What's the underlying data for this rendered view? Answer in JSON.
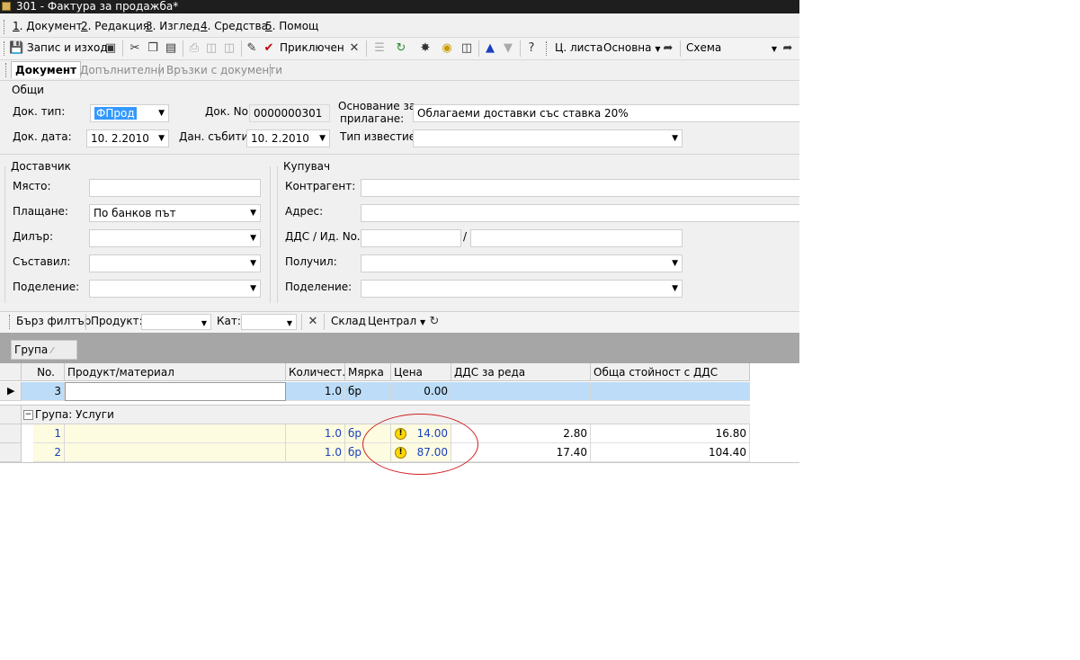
{
  "window": {
    "title": "301 - Фактура за продажба*"
  },
  "menu": [
    {
      "num": "1",
      "label": ". Документ"
    },
    {
      "num": "2",
      "label": ". Редакция"
    },
    {
      "num": "3",
      "label": ". Изглед"
    },
    {
      "num": "4",
      "label": ". Средства"
    },
    {
      "num": "5",
      "label": ". Помощ"
    }
  ],
  "toolbar": {
    "save_exit": "Запис и изход",
    "finish": "Приключен",
    "price_list_label": "Ц. листа",
    "price_list_value": "Основна",
    "scheme_label": "Схема",
    "scheme_value": ""
  },
  "tabs": {
    "document": "Документ",
    "additional": "Допълнителни",
    "links": "Връзки с документи"
  },
  "general": {
    "title": "Общи",
    "doc_type_label": "Док. тип:",
    "doc_type_value": "ФПрод",
    "doc_no_label": "Док. No.",
    "doc_no_value": "0000000301",
    "basis_label_1": "Основание за",
    "basis_label_2": "прилагане:",
    "basis_value": "Облагаеми доставки със ставка 20%",
    "doc_date_label": "Док. дата:",
    "doc_date_value": "10.  2.2010",
    "tax_event_label": "Дан. събитие:",
    "tax_event_value": "10.  2.2010",
    "notice_type_label": "Тип известие:",
    "notice_type_value": ""
  },
  "supplier": {
    "title": "Доставчик",
    "place_label": "Място:",
    "payment_label": "Плащане:",
    "payment_value": "По банков път",
    "dealer_label": "Дилър:",
    "compiled_label": "Съставил:",
    "division_label": "Поделение:"
  },
  "buyer": {
    "title": "Купувач",
    "counterparty_label": "Контрагент:",
    "address_label": "Адрес:",
    "vat_label": "ДДС / Ид. No.",
    "vat_sep": "/",
    "received_label": "Получил:",
    "division_label": "Поделение:"
  },
  "filter": {
    "quick": "Бърз филтър",
    "product_label": "Продукт:",
    "cat_label": "Кат:",
    "warehouse_label": "Склад",
    "warehouse_value": "Централ"
  },
  "grouping": {
    "chip": "Група"
  },
  "grid": {
    "headers": [
      "No.",
      "Продукт/материал",
      "Количест...",
      "Мярка",
      "Цена",
      "ДДС за реда",
      "Обща стойност с ДДС"
    ],
    "new_row": {
      "no": "3",
      "qty": "1.0",
      "unit": "бр",
      "price": "0.00"
    },
    "group_label": "Група: Услуги",
    "group_toggle": "−",
    "rows": [
      {
        "no": "1",
        "qty": "1.0",
        "unit": "бр",
        "price": "14.00",
        "vat": "2.80",
        "total": "16.80"
      },
      {
        "no": "2",
        "qty": "1.0",
        "unit": "бр",
        "price": "87.00",
        "vat": "17.40",
        "total": "104.40"
      }
    ]
  }
}
